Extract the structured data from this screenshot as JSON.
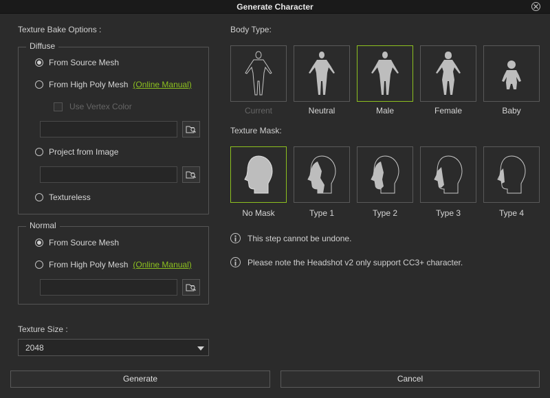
{
  "window": {
    "title": "Generate Character"
  },
  "texture_bake": {
    "heading": "Texture Bake Options :",
    "diffuse": {
      "title": "Diffuse",
      "from_source": "From Source Mesh",
      "from_high_poly": "From High Poly Mesh",
      "online_manual": "(Online Manual)",
      "use_vertex_color": "Use Vertex Color",
      "project_from_image": "Project from Image",
      "textureless": "Textureless",
      "selected": "From Source Mesh"
    },
    "normal": {
      "title": "Normal",
      "from_source": "From Source Mesh",
      "from_high_poly": "From High Poly Mesh",
      "online_manual": "(Online Manual)",
      "selected": "From Source Mesh"
    }
  },
  "texture_size": {
    "label": "Texture Size :",
    "value": "2048"
  },
  "body_type": {
    "label": "Body Type:",
    "items": [
      "Current",
      "Neutral",
      "Male",
      "Female",
      "Baby"
    ],
    "selected": "Male"
  },
  "texture_mask": {
    "label": "Texture Mask:",
    "items": [
      "No Mask",
      "Type 1",
      "Type 2",
      "Type 3",
      "Type 4"
    ],
    "selected": "No Mask"
  },
  "notes": [
    "This step cannot be undone.",
    "Please note the Headshot v2 only support CC3+ character."
  ],
  "buttons": {
    "generate": "Generate",
    "cancel": "Cancel"
  },
  "colors": {
    "accent": "#8ec21f",
    "background": "#2b2b2b",
    "titlebar": "#1a1a1a"
  }
}
